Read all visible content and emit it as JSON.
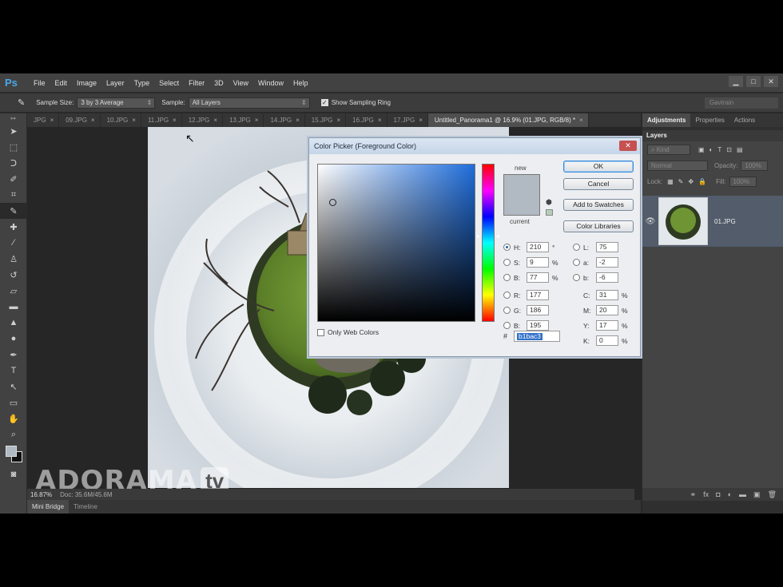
{
  "app": {
    "logo": "Ps"
  },
  "menu": [
    "File",
    "Edit",
    "Image",
    "Layer",
    "Type",
    "Select",
    "Filter",
    "3D",
    "View",
    "Window",
    "Help"
  ],
  "options_bar": {
    "sample_size_label": "Sample Size:",
    "sample_size_value": "3 by 3 Average",
    "sample_label": "Sample:",
    "sample_value": "All Layers",
    "show_ring_label": "Show Sampling Ring",
    "workspace": "Gavtrain"
  },
  "tabs": [
    {
      "label": "JPG",
      "active": false
    },
    {
      "label": "09.JPG",
      "active": false
    },
    {
      "label": "10.JPG",
      "active": false
    },
    {
      "label": "11.JPG",
      "active": false
    },
    {
      "label": "12.JPG",
      "active": false
    },
    {
      "label": "13.JPG",
      "active": false
    },
    {
      "label": "14.JPG",
      "active": false
    },
    {
      "label": "15.JPG",
      "active": false
    },
    {
      "label": "16.JPG",
      "active": false
    },
    {
      "label": "17.JPG",
      "active": false
    },
    {
      "label": "Untitled_Panorama1 @ 16.9% (01.JPG, RGB/8) *",
      "active": true
    }
  ],
  "status": {
    "zoom": "16.87%",
    "doc": "Doc: 35.6M/45.6M"
  },
  "bottom_tabs": [
    "Mini Bridge",
    "Timeline"
  ],
  "watermark": {
    "brand": "ADORAMA",
    "tv": "tv"
  },
  "panels": {
    "tabs": [
      "Adjustments",
      "Properties",
      "Actions"
    ],
    "layers_title": "Layers",
    "kind": "Kind",
    "blend": "Normal",
    "opacity_label": "Opacity:",
    "opacity_value": "100%",
    "lock_label": "Lock:",
    "fill_label": "Fill:",
    "fill_value": "100%",
    "layer_name": "01.JPG"
  },
  "color_picker": {
    "title": "Color Picker (Foreground Color)",
    "buttons": {
      "ok": "OK",
      "cancel": "Cancel",
      "add_swatches": "Add to Swatches",
      "libraries": "Color Libraries"
    },
    "new_label": "new",
    "current_label": "current",
    "swatch_color": "#b1bac3",
    "hsb": [
      {
        "label": "H:",
        "value": "210",
        "unit": "°"
      },
      {
        "label": "S:",
        "value": "9",
        "unit": "%"
      },
      {
        "label": "B:",
        "value": "77",
        "unit": "%"
      }
    ],
    "rgb": [
      {
        "label": "R:",
        "value": "177"
      },
      {
        "label": "G:",
        "value": "186"
      },
      {
        "label": "B:",
        "value": "195"
      }
    ],
    "lab": [
      {
        "label": "L:",
        "value": "75"
      },
      {
        "label": "a:",
        "value": "-2"
      },
      {
        "label": "b:",
        "value": "-6"
      }
    ],
    "cmyk": [
      {
        "label": "C:",
        "value": "31",
        "unit": "%"
      },
      {
        "label": "M:",
        "value": "20",
        "unit": "%"
      },
      {
        "label": "Y:",
        "value": "17",
        "unit": "%"
      },
      {
        "label": "K:",
        "value": "0",
        "unit": "%"
      }
    ],
    "only_web": "Only Web Colors",
    "hash": "#",
    "hex": "b1bac3"
  }
}
